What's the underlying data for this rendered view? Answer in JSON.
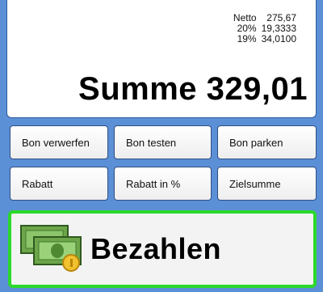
{
  "totals": {
    "tax_rows": [
      {
        "label": "Netto",
        "value": "275,67"
      },
      {
        "label": "20%",
        "value": "19,3333"
      },
      {
        "label": "19%",
        "value": "34,0100"
      }
    ],
    "sum_label": "Summe",
    "sum_value": "329,01"
  },
  "buttons": {
    "discard": "Bon verwerfen",
    "test": "Bon testen",
    "park": "Bon parken",
    "discount": "Rabatt",
    "discount_percent": "Rabatt in %",
    "target_sum": "Zielsumme"
  },
  "pay": {
    "label": "Bezahlen",
    "icon": "money-icon",
    "border_color": "#2bd92b"
  }
}
